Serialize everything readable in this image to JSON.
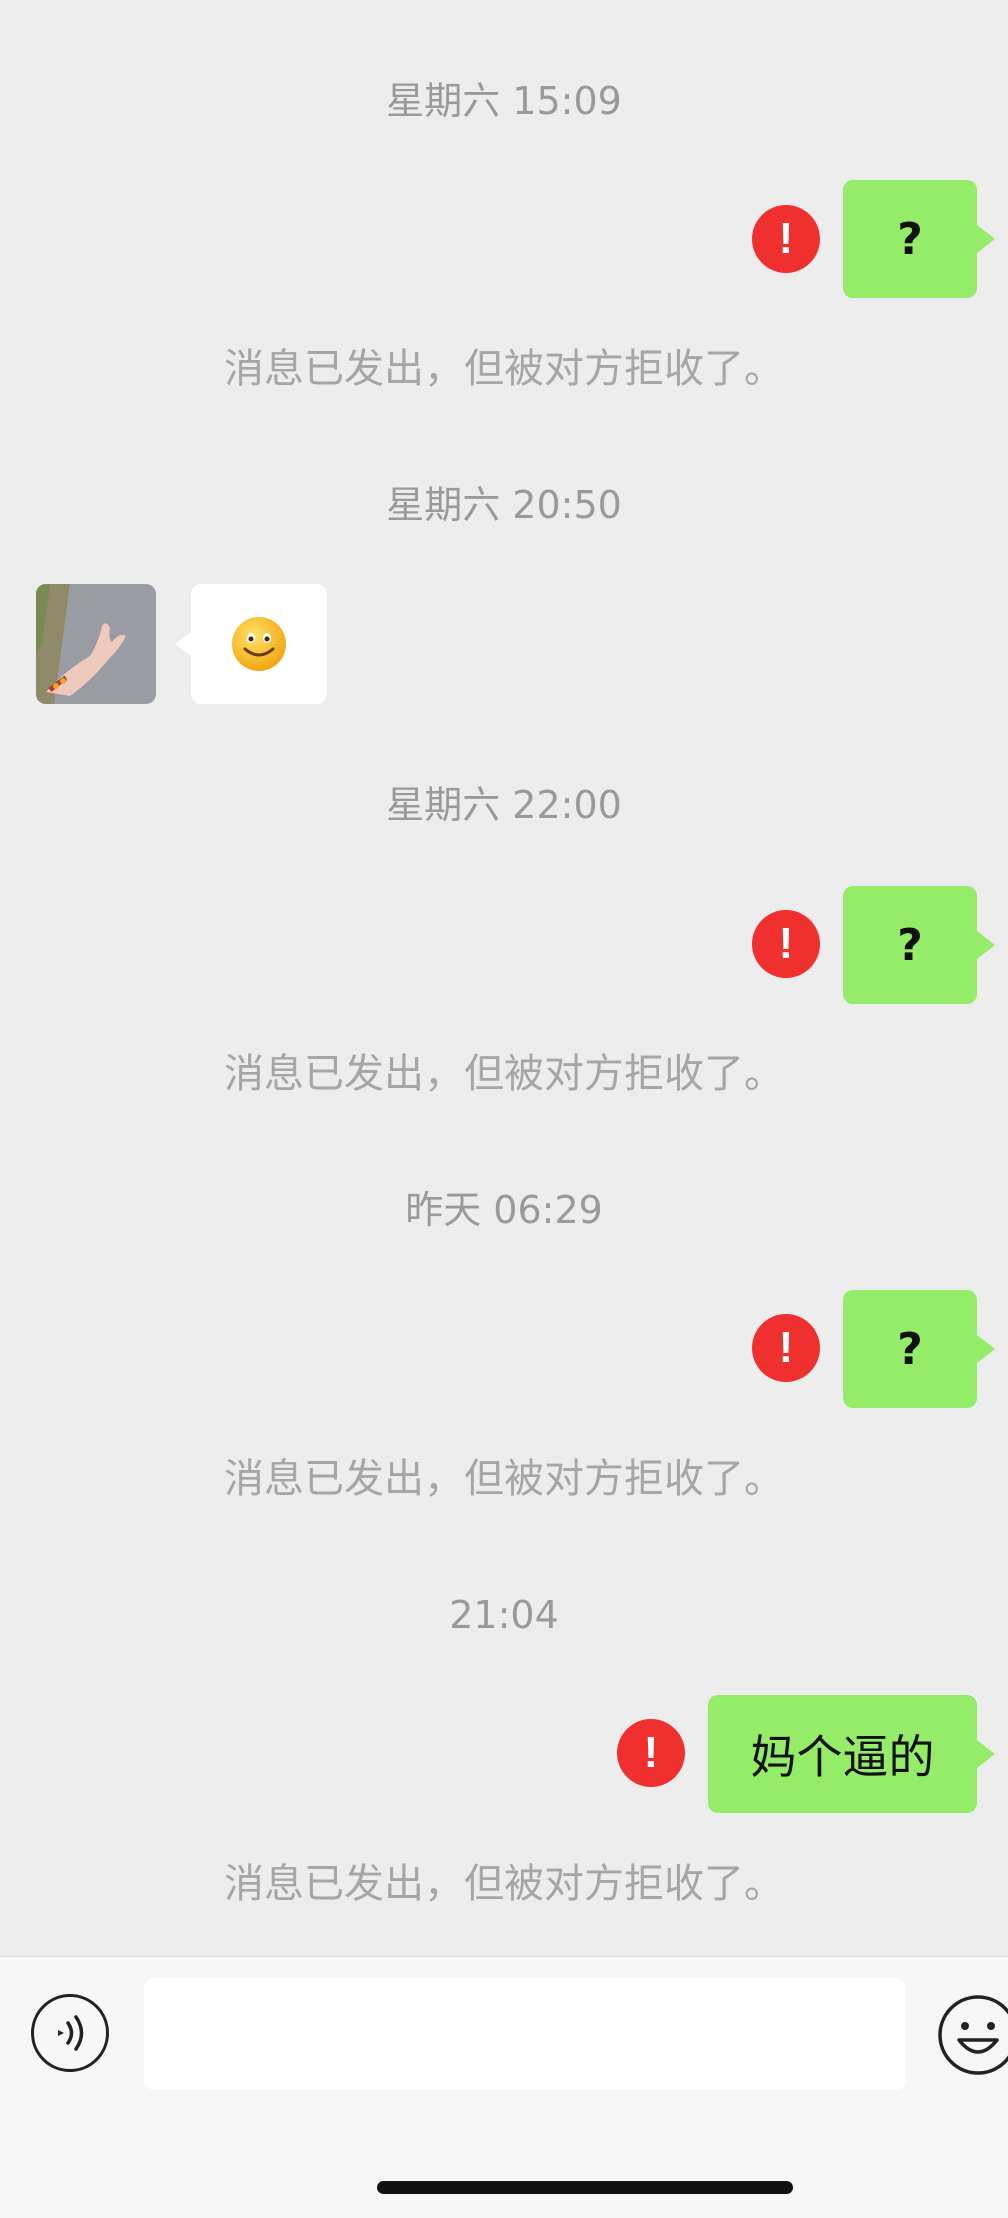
{
  "messages": {
    "ts1": "星期六 15:09",
    "m1": "?",
    "sys1": "消息已发出，但被对方拒收了。",
    "ts2": "星期六 20:50",
    "ts3": "星期六 22:00",
    "m3": "?",
    "sys3": "消息已发出，但被对方拒收了。",
    "ts4": "昨天 06:29",
    "m4": "?",
    "sys4": "消息已发出，但被对方拒收了。",
    "ts5": "21:04",
    "m5": "妈个逼的",
    "sys5": "消息已发出，但被对方拒收了。",
    "error_mark": "!"
  },
  "icons": {
    "received": "smiley-emoji-icon",
    "voice": "voice-icon",
    "emoji": "emoji-icon",
    "error": "error-icon"
  },
  "colors": {
    "sent_bubble": "#95ec69",
    "error_badge": "#f0302f",
    "chat_bg": "#ededed"
  }
}
